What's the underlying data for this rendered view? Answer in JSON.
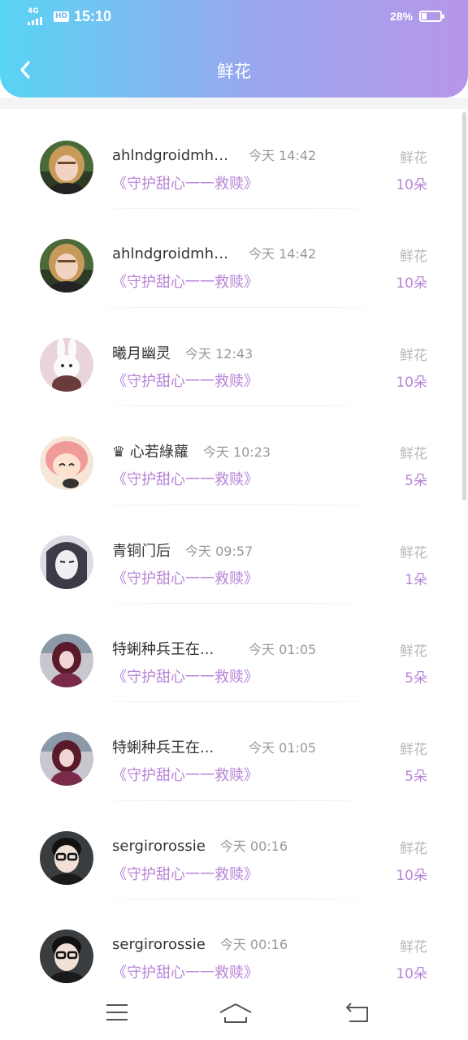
{
  "status": {
    "network": "4G",
    "hd": "HD",
    "time": "15:10",
    "battery": "28%",
    "battery_level": 0.28
  },
  "header": {
    "title": "鲜花"
  },
  "rows": [
    {
      "name": "ahlndgroidmhk...",
      "time": "今天 14:42",
      "gift": "《守护甜心一一救赎》",
      "kind": "鲜花",
      "count": "10朵",
      "avatar": "girl-blonde"
    },
    {
      "name": "ahlndgroidmhk...",
      "time": "今天 14:42",
      "gift": "《守护甜心一一救赎》",
      "kind": "鲜花",
      "count": "10朵",
      "avatar": "girl-blonde"
    },
    {
      "name": "曦月幽灵",
      "time": "今天 12:43",
      "gift": "《守护甜心一一救赎》",
      "kind": "鲜花",
      "count": "10朵",
      "avatar": "rabbit"
    },
    {
      "name": "♛ 心若綠蘿",
      "time": "今天 10:23",
      "gift": "《守护甜心一一救赎》",
      "kind": "鲜花",
      "count": "5朵",
      "avatar": "anime-pink"
    },
    {
      "name": "青铜门后",
      "time": "今天 09:57",
      "gift": "《守护甜心一一救赎》",
      "kind": "鲜花",
      "count": "1朵",
      "avatar": "anime-sketch"
    },
    {
      "name": "特蜊种兵王在...",
      "time": "今天 01:05",
      "gift": "《守护甜心一一救赎》",
      "kind": "鲜花",
      "count": "5朵",
      "avatar": "girl-red"
    },
    {
      "name": "特蜊种兵王在...",
      "time": "今天 01:05",
      "gift": "《守护甜心一一救赎》",
      "kind": "鲜花",
      "count": "5朵",
      "avatar": "girl-red"
    },
    {
      "name": "sergirorossie",
      "time": "今天 00:16",
      "gift": "《守护甜心一一救赎》",
      "kind": "鲜花",
      "count": "10朵",
      "avatar": "boy-glasses"
    },
    {
      "name": "sergirorossie",
      "time": "今天 00:16",
      "gift": "《守护甜心一一救赎》",
      "kind": "鲜花",
      "count": "10朵",
      "avatar": "boy-glasses"
    }
  ],
  "navbar": {
    "menu_icon": "menu-icon",
    "home_icon": "home-icon",
    "back_icon": "back-icon"
  },
  "colors": {
    "accent": "#b884d8",
    "gradient_start": "#58d4f4",
    "gradient_end": "#b796ea",
    "muted": "#b8b8b8"
  }
}
